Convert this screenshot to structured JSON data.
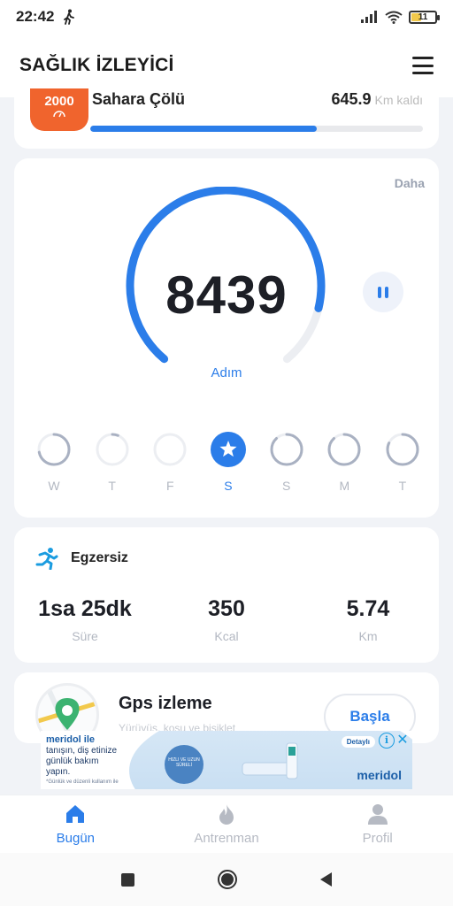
{
  "status_bar": {
    "time": "22:42",
    "battery": "11"
  },
  "header": {
    "title": "SAĞLIK İZLEYİCİ"
  },
  "challenge": {
    "badge": "2000",
    "name": "Sahara Çölü",
    "remaining_value": "645.9",
    "remaining_unit": "Km kaldı",
    "progress": 0.68
  },
  "steps": {
    "more": "Daha",
    "count": "8439",
    "label": "Adım",
    "goal_fraction": 0.87
  },
  "week": [
    {
      "label": "W",
      "fraction": 0.72,
      "active": false
    },
    {
      "label": "T",
      "fraction": 0.06,
      "active": false
    },
    {
      "label": "F",
      "fraction": 0.0,
      "active": false
    },
    {
      "label": "S",
      "fraction": 1.0,
      "active": true
    },
    {
      "label": "S",
      "fraction": 0.88,
      "active": false
    },
    {
      "label": "M",
      "fraction": 0.88,
      "active": false
    },
    {
      "label": "T",
      "fraction": 0.82,
      "active": false
    }
  ],
  "exercise": {
    "title": "Egzersiz",
    "stats": [
      {
        "value": "1sa 25dk",
        "label": "Süre"
      },
      {
        "value": "350",
        "label": "Kcal"
      },
      {
        "value": "5.74",
        "label": "Km"
      }
    ]
  },
  "gps": {
    "title": "Gps izleme",
    "subtitle": "Yürüyüş, koşu ve bisiklet",
    "start": "Başla"
  },
  "ad": {
    "brand": "meridol ile",
    "line1": "tanışın, diş etinize",
    "line2": "günlük bakım",
    "line3": "yapın.",
    "fine": "*Günlük ve düzenli kullanım ile",
    "badge_text": "HIZLI VE UZUN SÜRELİ",
    "logo": "meridol",
    "cta": "Detaylı"
  },
  "bottom_nav": [
    {
      "label": "Bugün",
      "icon": "home-icon",
      "active": true
    },
    {
      "label": "Antrenman",
      "icon": "flame-icon",
      "active": false
    },
    {
      "label": "Profil",
      "icon": "person-icon",
      "active": false
    }
  ],
  "colors": {
    "accent": "#2b7de9",
    "badge": "#f0642d",
    "background": "#f1f3f7"
  }
}
